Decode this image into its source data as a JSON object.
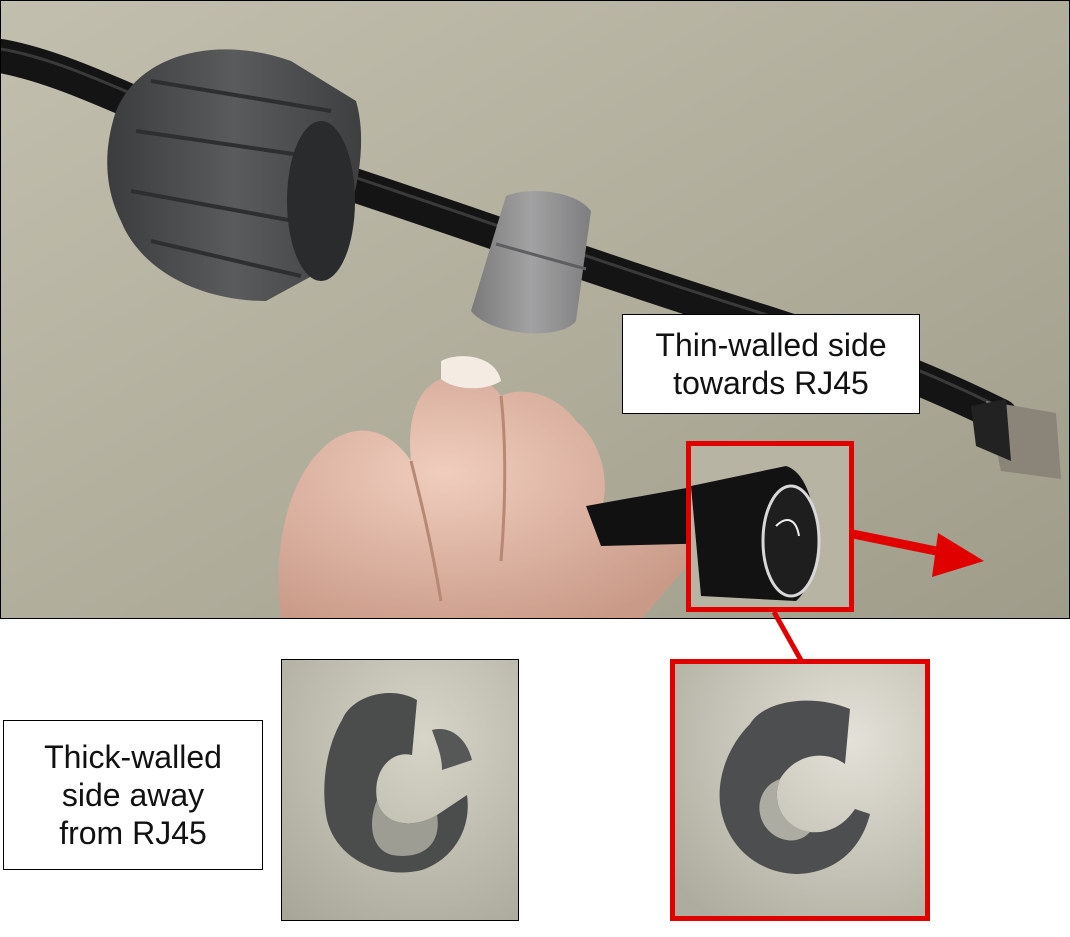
{
  "labels": {
    "thin_side": [
      "Thin-walled side",
      "towards RJ45"
    ],
    "thick_side": [
      "Thick-walled",
      "side away",
      "from RJ45"
    ]
  },
  "colors": {
    "highlight": "#e00000",
    "background_surface": "#b3b1a1",
    "cable": "#141414",
    "gland_nut": "#4a4b4d",
    "seal_ring": "#8d8d8e",
    "skin": "#e2b8a6"
  },
  "icons": {
    "arrow": "red-arrow-right",
    "connector_line": "red-callout-line"
  }
}
